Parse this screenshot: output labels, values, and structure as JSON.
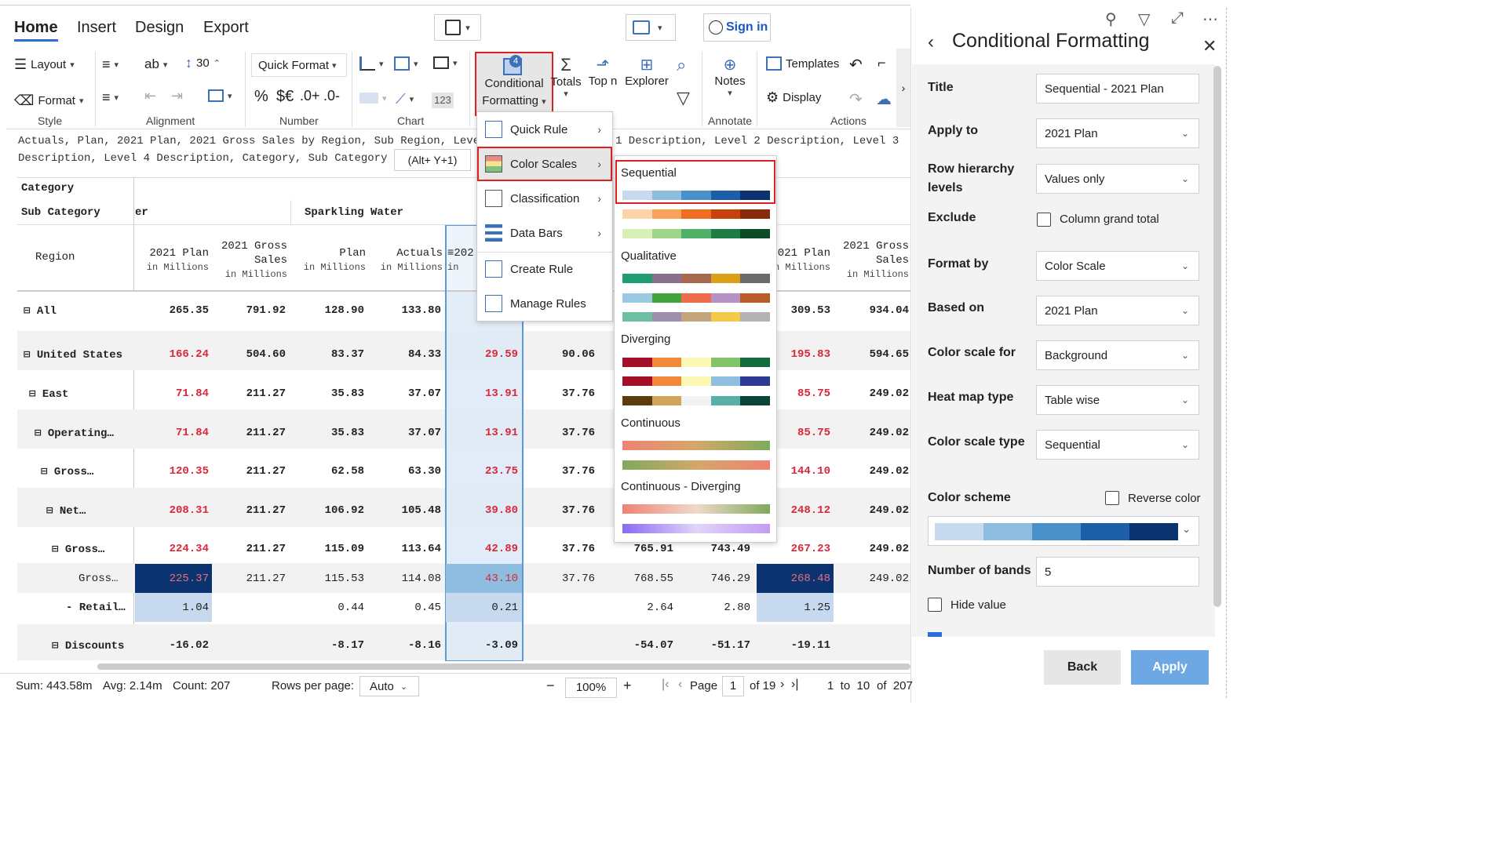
{
  "ribbon": {
    "tabs": [
      "Home",
      "Insert",
      "Design",
      "Export"
    ],
    "active_tab": "Home",
    "layout_label": "Layout",
    "format_label": "Format",
    "style_label": "Style",
    "alignment_label": "Alignment",
    "number_label": "Number",
    "chart_label": "Chart",
    "font_size": "30",
    "quick_format_label": "Quick Format",
    "percent": "%",
    "currency": "$€",
    "inc_decimal": ".0+",
    "dec_decimal": ".0-",
    "num_123": "123",
    "cf_badge": "4",
    "cf_label1": "Conditional",
    "cf_label2": "Formatting",
    "totals_label": "Totals",
    "topn_label": "Top n",
    "explorer_label": "Explorer",
    "notes_label": "Notes",
    "annotate_label": "Annotate",
    "templates_label": "Templates",
    "display_label": "Display",
    "actions_label": "Actions",
    "sign_in": "Sign in"
  },
  "fields_line1": "Actuals, Plan, 2021 Plan, 2021 Gross Sales by Region, Sub Region, Level",
  "fields_line1b": "1 Description, Level 2 Description, Level 3",
  "fields_line2": "Description, Level 4 Description, Category, Sub Category",
  "shortcut_tooltip": "(Alt+ Y+1)",
  "table": {
    "category_label": "Category",
    "subcategory_label": "Sub Category",
    "region_label": "Region",
    "group_left_partial": "er",
    "group_sparkling": "Sparkling Water",
    "col_2021plan": "2021 Plan",
    "col_2021gross_a": "2021 Gross",
    "col_2021gross_b": "Sales",
    "col_plan": "Plan",
    "col_actuals": "Actuals",
    "col_partial": "202",
    "col_partial_sub": "in",
    "col_2021plan_partial": "2021 Plan",
    "col_2021plan_partial_sub": "n Millions",
    "in_millions": "in Millions",
    "rows": [
      {
        "label": "All",
        "c1": "265.35",
        "c2": "791.92",
        "c3": "128.90",
        "c4": "133.80",
        "c5": "",
        "c6": "",
        "c7": "",
        "c8": "",
        "c9": "309.53",
        "c10": "934.04"
      },
      {
        "label": "United States",
        "c1": "166.24",
        "c2": "504.60",
        "c3": "83.37",
        "c4": "84.33",
        "c5": "29.59",
        "c6": "90.06",
        "c7": "",
        "c8": "",
        "c9": "195.83",
        "c10": "594.65"
      },
      {
        "label": "East",
        "c1": "71.84",
        "c2": "211.27",
        "c3": "35.83",
        "c4": "37.07",
        "c5": "13.91",
        "c6": "37.76",
        "c7": "",
        "c8": "",
        "c9": "85.75",
        "c10": "249.02"
      },
      {
        "label": "Operating…",
        "c1": "71.84",
        "c2": "211.27",
        "c3": "35.83",
        "c4": "37.07",
        "c5": "13.91",
        "c6": "37.76",
        "c7": "",
        "c8": "",
        "c9": "85.75",
        "c10": "249.02"
      },
      {
        "label": "Gross…",
        "c1": "120.35",
        "c2": "211.27",
        "c3": "62.58",
        "c4": "63.30",
        "c5": "23.75",
        "c6": "37.76",
        "c7": "",
        "c8": "",
        "c9": "144.10",
        "c10": "249.02"
      },
      {
        "label": "Net…",
        "c1": "208.31",
        "c2": "211.27",
        "c3": "106.92",
        "c4": "105.48",
        "c5": "39.80",
        "c6": "37.76",
        "c7": "",
        "c8": "",
        "c9": "248.12",
        "c10": "249.02"
      },
      {
        "label": "Gross…",
        "c1": "224.34",
        "c2": "211.27",
        "c3": "115.09",
        "c4": "113.64",
        "c5": "42.89",
        "c6": "37.76",
        "c7": "765.91",
        "c8": "743.49",
        "c9": "267.23",
        "c10": "249.02"
      },
      {
        "label": "Gross…",
        "c1": "225.37",
        "c2": "211.27",
        "c3": "115.53",
        "c4": "114.08",
        "c5": "43.10",
        "c6": "37.76",
        "c7": "768.55",
        "c8": "746.29",
        "c9": "268.48",
        "c10": "249.02"
      },
      {
        "label": "Retail…",
        "c1": "1.04",
        "c2": "",
        "c3": "0.44",
        "c4": "0.45",
        "c5": "0.21",
        "c6": "",
        "c7": "2.64",
        "c8": "2.80",
        "c9": "1.25",
        "c10": ""
      },
      {
        "label": "Discounts",
        "c1": "-16.02",
        "c2": "",
        "c3": "-8.17",
        "c4": "-8.16",
        "c5": "-3.09",
        "c6": "",
        "c7": "-54.07",
        "c8": "-51.17",
        "c9": "-19.11",
        "c10": ""
      }
    ]
  },
  "cf_menu": {
    "items": [
      "Quick Rule",
      "Color Scales",
      "Classification",
      "Data Bars",
      "Create Rule",
      "Manage Rules"
    ]
  },
  "color_scales": {
    "sequential": "Sequential",
    "qualitative": "Qualitative",
    "diverging": "Diverging",
    "continuous": "Continuous",
    "continuous_diverging": "Continuous - Diverging",
    "seq_blue": [
      "#c6d9ef",
      "#8fbde0",
      "#4a90c9",
      "#1c5fa8",
      "#0b3370"
    ],
    "seq_orange": [
      "#fdd4a9",
      "#f8a35a",
      "#ee6d20",
      "#c9410a",
      "#8a2b0b"
    ],
    "seq_green": [
      "#d8efb6",
      "#9fd589",
      "#4fb067",
      "#1d7c43",
      "#0b4b25"
    ],
    "qual_1": [
      "#1f9c74",
      "#8c6f8e",
      "#a56a4e",
      "#d9a018",
      "#6b6b6b"
    ],
    "qual_2": [
      "#9dc8e4",
      "#43a33d",
      "#ee6c4a",
      "#b591c6",
      "#b95d26"
    ],
    "qual_3": [
      "#6cbfa0",
      "#9d90ad",
      "#c2a57b",
      "#f3c94a",
      "#b3b3b3"
    ],
    "div_1": [
      "#a30f28",
      "#f08a3a",
      "#fbf8b6",
      "#82c36a",
      "#116b3b"
    ],
    "div_2": [
      "#a30f28",
      "#f08a3a",
      "#fbf8b6",
      "#8ebfde",
      "#2e3a94"
    ],
    "div_3": [
      "#5c3b0c",
      "#d2a45a",
      "#f2f2f2",
      "#59b1a6",
      "#0b4337"
    ]
  },
  "panel": {
    "title": "Conditional Formatting",
    "title_label": "Title",
    "title_value": "Sequential - 2021 Plan",
    "apply_to_label": "Apply to",
    "apply_to_value": "2021 Plan",
    "row_hier_label1": "Row hierarchy",
    "row_hier_label2": "levels",
    "row_hier_value": "Values only",
    "exclude_label": "Exclude",
    "exclude_value": "Column grand total",
    "format_by_label": "Format by",
    "format_by_value": "Color Scale",
    "based_on_label": "Based on",
    "based_on_value": "2021 Plan",
    "color_scale_for_label": "Color scale for",
    "color_scale_for_value": "Background",
    "heat_map_label": "Heat map type",
    "heat_map_value": "Table wise",
    "cs_type_label": "Color scale type",
    "cs_type_value": "Sequential",
    "color_scheme_label": "Color scheme",
    "reverse_color": "Reverse color",
    "bands_label": "Number of bands",
    "bands_value": "5",
    "hide_value": "Hide value",
    "back": "Back",
    "apply": "Apply"
  },
  "status": {
    "sum": "Sum: 443.58m",
    "avg": "Avg: 2.14m",
    "count": "Count: 207",
    "rows_per_page_label": "Rows per page:",
    "rows_per_page_value": "Auto",
    "zoom": "100%",
    "page_label": "Page",
    "page_value": "1",
    "page_of": "of 19",
    "range": "1  to  10",
    "range_of": "of  207"
  }
}
